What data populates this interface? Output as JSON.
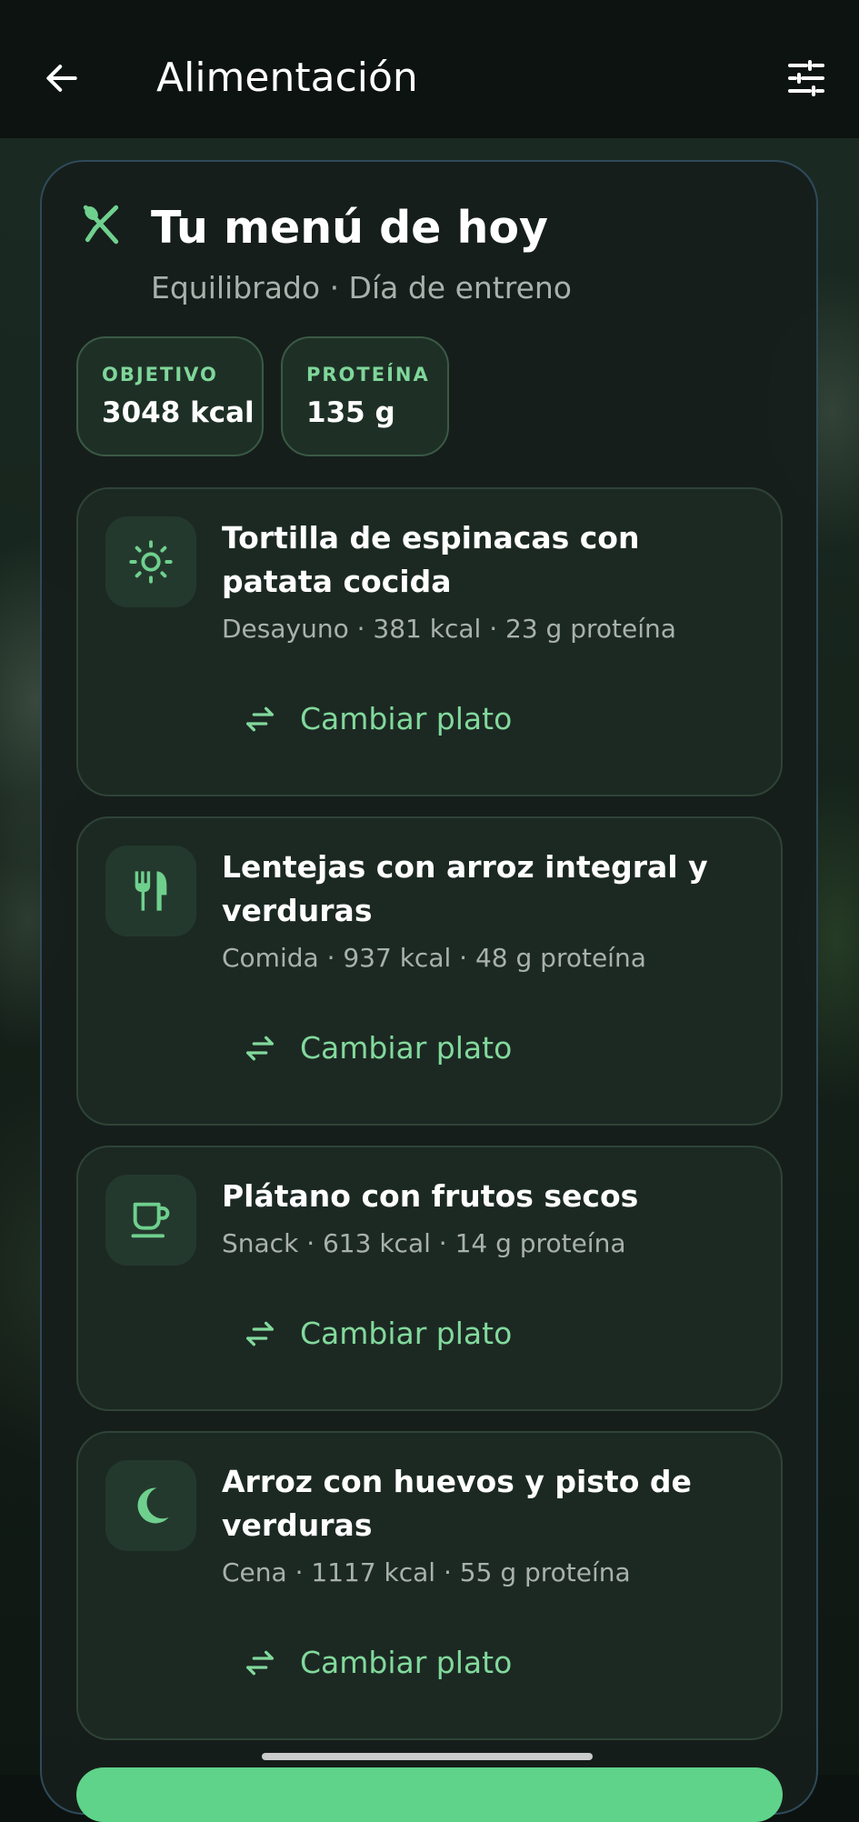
{
  "appbar": {
    "title": "Alimentación",
    "back_icon": "arrow-left-icon",
    "filter_icon": "tune-sliders-icon"
  },
  "menu": {
    "icon": "fork-spoon-icon",
    "title": "Tu menú de hoy",
    "subtitle": "Equilibrado · Día de entreno"
  },
  "stats": [
    {
      "label": "OBJETIVO",
      "value": "3048 kcal"
    },
    {
      "label": "PROTEÍNA",
      "value": "135 g"
    }
  ],
  "meals": [
    {
      "icon": "sun-icon",
      "name": "Tortilla de espinacas con patata cocida",
      "info": "Desayuno · 381 kcal · 23 g proteína",
      "action": "Cambiar plato"
    },
    {
      "icon": "restaurant-icon",
      "name": "Lentejas con arroz integral y verduras",
      "info": "Comida · 937 kcal · 48 g proteína",
      "action": "Cambiar plato"
    },
    {
      "icon": "coffee-cup-icon",
      "name": "Plátano con frutos secos",
      "info": "Snack · 613 kcal · 14 g proteína",
      "action": "Cambiar plato"
    },
    {
      "icon": "moon-icon",
      "name": "Arroz con huevos y pisto de verduras",
      "info": "Cena · 1117 kcal · 55 g proteína",
      "action": "Cambiar plato"
    }
  ],
  "colors": {
    "accent": "#82d99c",
    "chip_label": "#7fd69a",
    "card_bg": "#1c2923",
    "muted_text": "#a9b1ad"
  }
}
